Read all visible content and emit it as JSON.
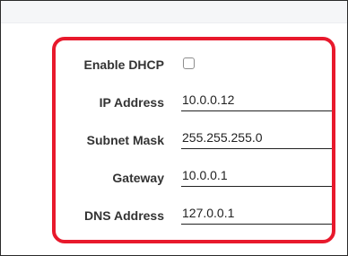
{
  "form": {
    "dhcp": {
      "label": "Enable DHCP",
      "checked": false
    },
    "ip": {
      "label": "IP Address",
      "value": "10.0.0.12"
    },
    "subnet": {
      "label": "Subnet Mask",
      "value": "255.255.255.0"
    },
    "gateway": {
      "label": "Gateway",
      "value": "10.0.0.1"
    },
    "dns": {
      "label": "DNS Address",
      "value": "127.0.0.1"
    }
  },
  "colors": {
    "highlight": "#e8192c",
    "label": "#333333",
    "text": "#222222"
  }
}
